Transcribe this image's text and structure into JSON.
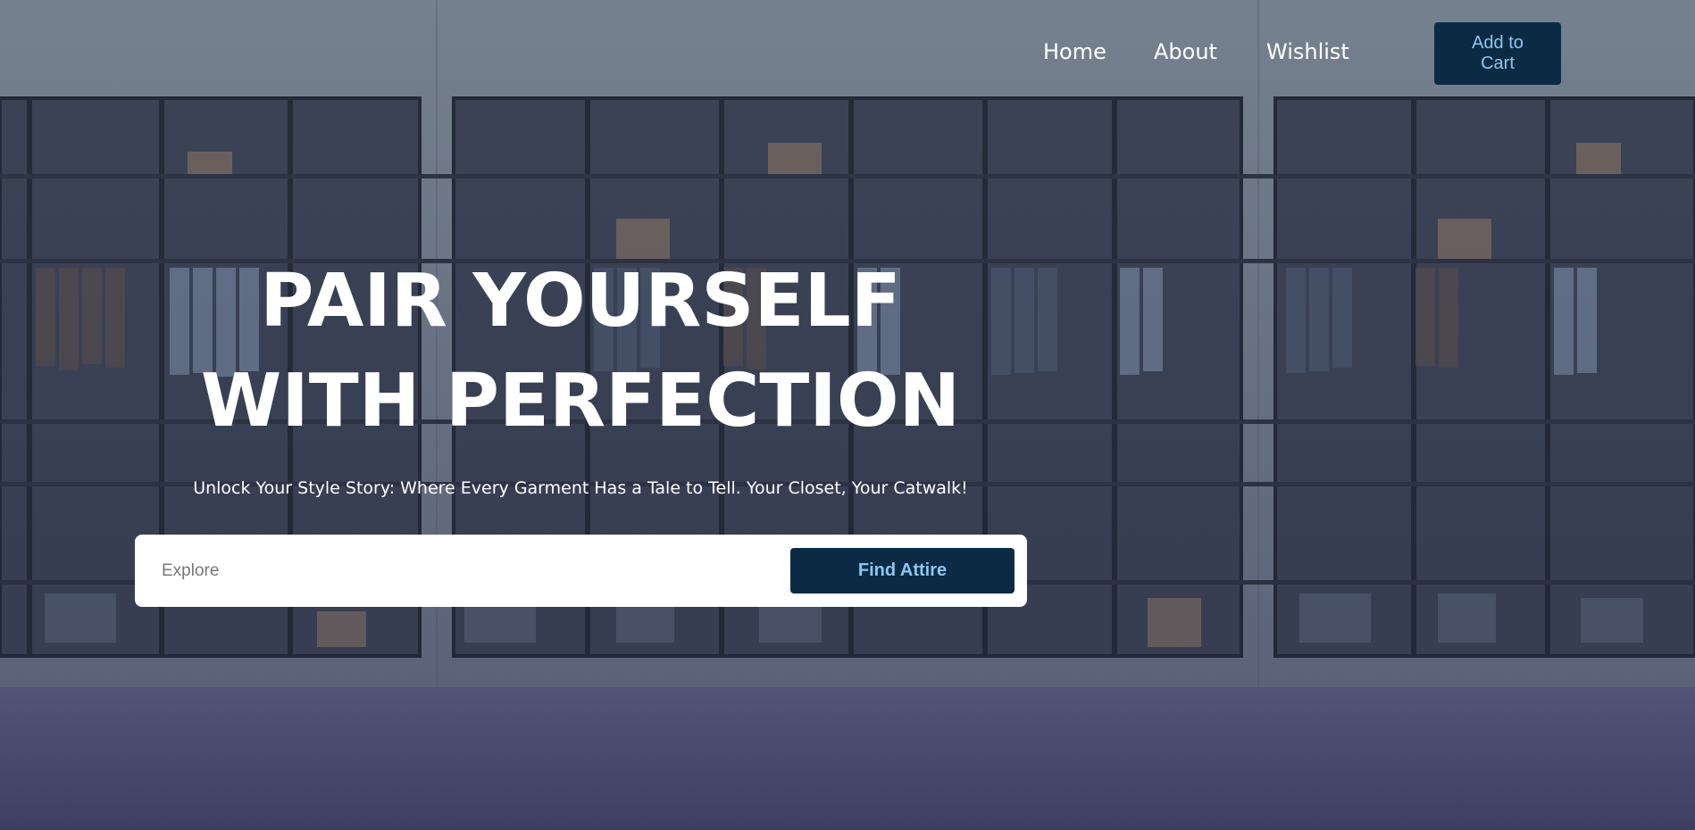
{
  "nav": {
    "links": [
      "Home",
      "About",
      "Wishlist"
    ],
    "cart_label": "Add to\nCart"
  },
  "hero": {
    "title_line1": "PAIR YOURSELF",
    "title_line2": "WITH PERFECTION",
    "tagline": "Unlock Your Style Story: Where Every Garment Has a Tale to Tell. Your Closet, Your Catwalk!"
  },
  "search": {
    "placeholder": "Explore",
    "button_label": "Find Attire"
  },
  "colors": {
    "button_bg": "#0b2b45",
    "button_text": "#8fc6ef"
  }
}
